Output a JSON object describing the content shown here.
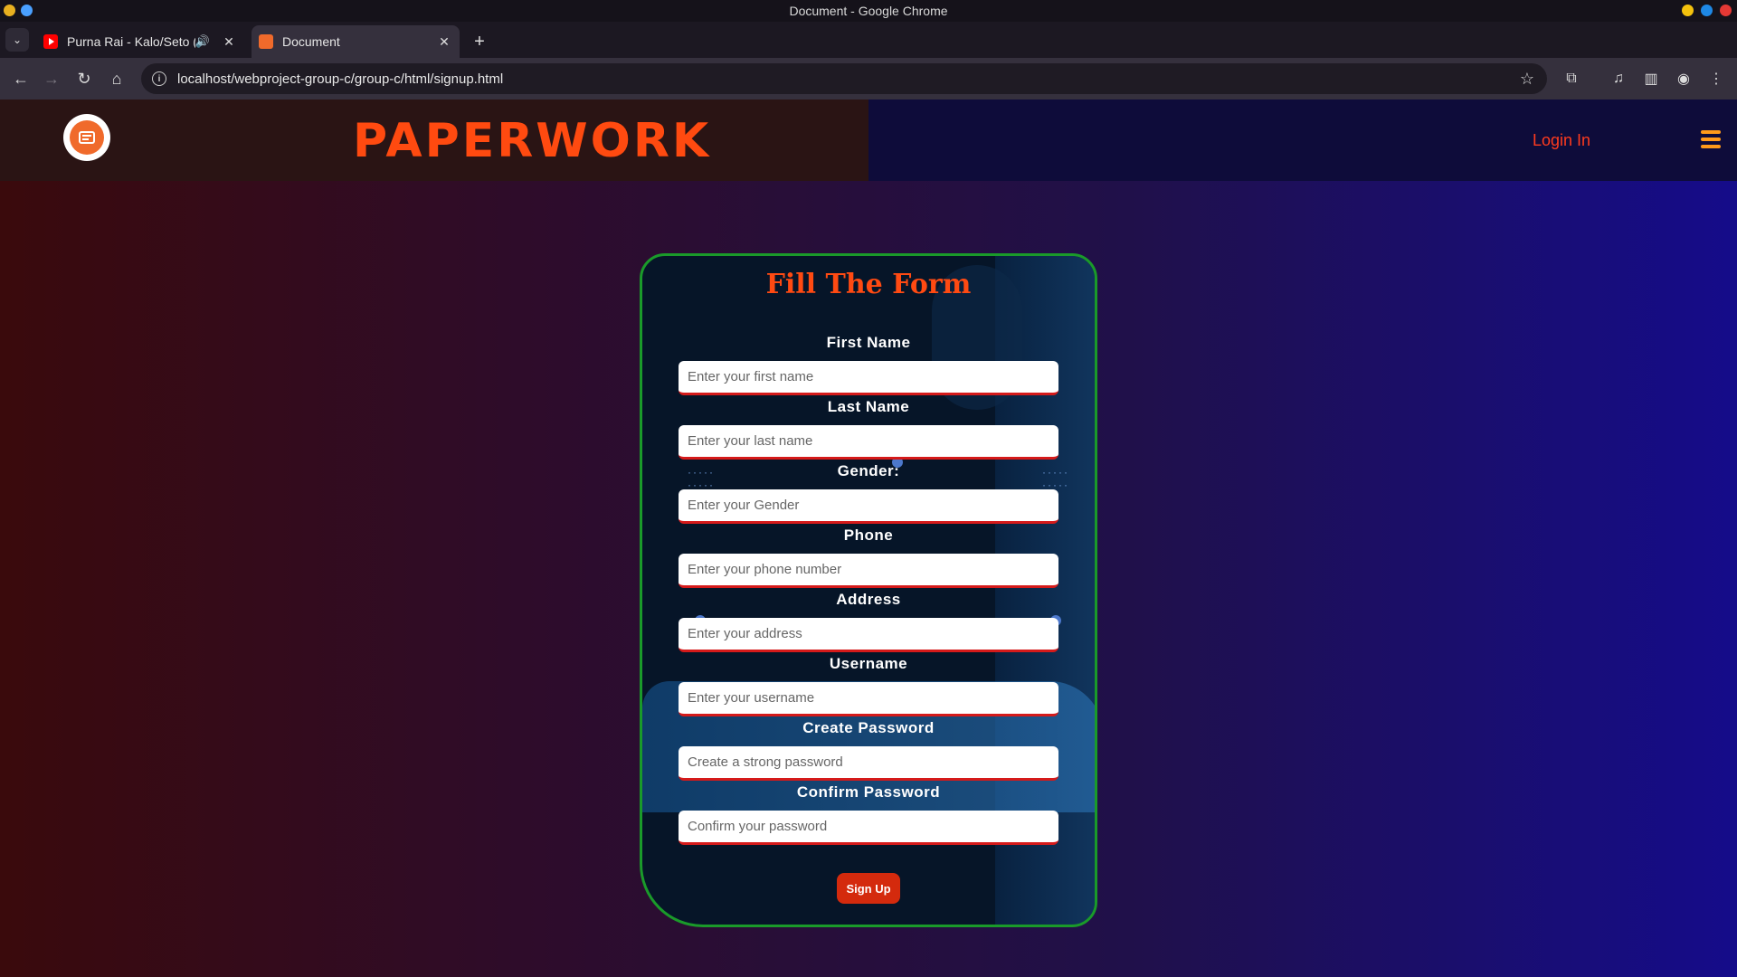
{
  "os": {
    "window_title": "Document - Google Chrome"
  },
  "browser": {
    "tabs": [
      {
        "title": "Purna Rai - Kalo/Seto (of",
        "active": false
      },
      {
        "title": "Document",
        "active": true
      }
    ],
    "address": "localhost/webproject-group-c/group-c/html/signup.html"
  },
  "header": {
    "brand": "PAPERWORK",
    "login_label": "Login In"
  },
  "form": {
    "title": "Fill The Form",
    "fields": [
      {
        "label": "First Name",
        "placeholder": "Enter your first name"
      },
      {
        "label": "Last Name",
        "placeholder": "Enter your last name"
      },
      {
        "label": "Gender:",
        "placeholder": "Enter your Gender"
      },
      {
        "label": "Phone",
        "placeholder": "Enter your phone number"
      },
      {
        "label": "Address",
        "placeholder": "Enter your address"
      },
      {
        "label": "Username",
        "placeholder": "Enter your username"
      },
      {
        "label": "Create Password",
        "placeholder": "Create a strong password"
      },
      {
        "label": "Confirm Password",
        "placeholder": "Confirm your password"
      }
    ],
    "submit_label": "Sign Up"
  },
  "colors": {
    "brand_orange": "#ff4a10",
    "card_border": "#1a9a2a",
    "input_underline": "#d51a1a",
    "button": "#d42a0d"
  }
}
